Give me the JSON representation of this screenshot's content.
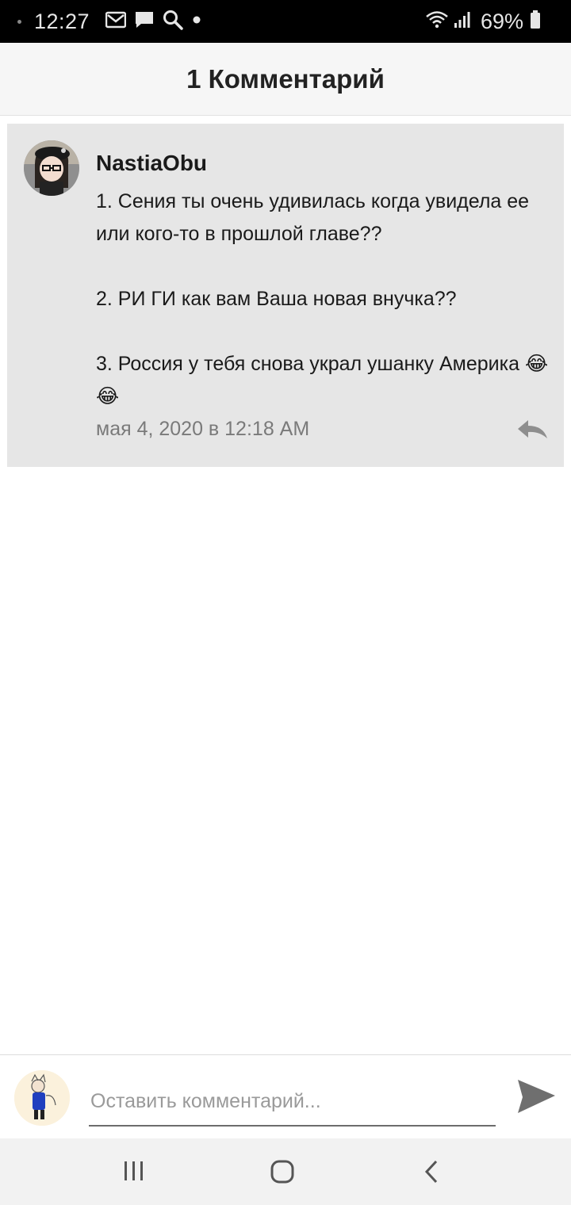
{
  "status_bar": {
    "time": "12:27",
    "battery_percent": "69%",
    "icons": [
      "gmail-icon",
      "message-icon",
      "search-icon",
      "notification-dot-icon",
      "wifi-icon",
      "signal-icon",
      "battery-icon"
    ]
  },
  "header": {
    "title": "1 Комментарий"
  },
  "comment": {
    "author": "NastiaObu",
    "text": "1. Сения ты очень удивилась когда увидела ее или кого-то в прошлой главе??\n\n2. РИ ГИ как вам Ваша новая внучка??\n\n3. Россия у тебя снова украл ушанку Америка 😂😂",
    "date": "мая 4, 2020 в 12:18 AM",
    "reply_icon": "reply-icon"
  },
  "composer": {
    "placeholder": "Оставить комментарий...",
    "value": "",
    "send_icon": "send-icon"
  },
  "nav_bar": {
    "icons": [
      "recent-apps-icon",
      "home-icon",
      "back-icon"
    ]
  },
  "colors": {
    "card_bg": "#e6e6e6",
    "header_bg": "#f6f6f6",
    "status_bg": "#000000"
  }
}
